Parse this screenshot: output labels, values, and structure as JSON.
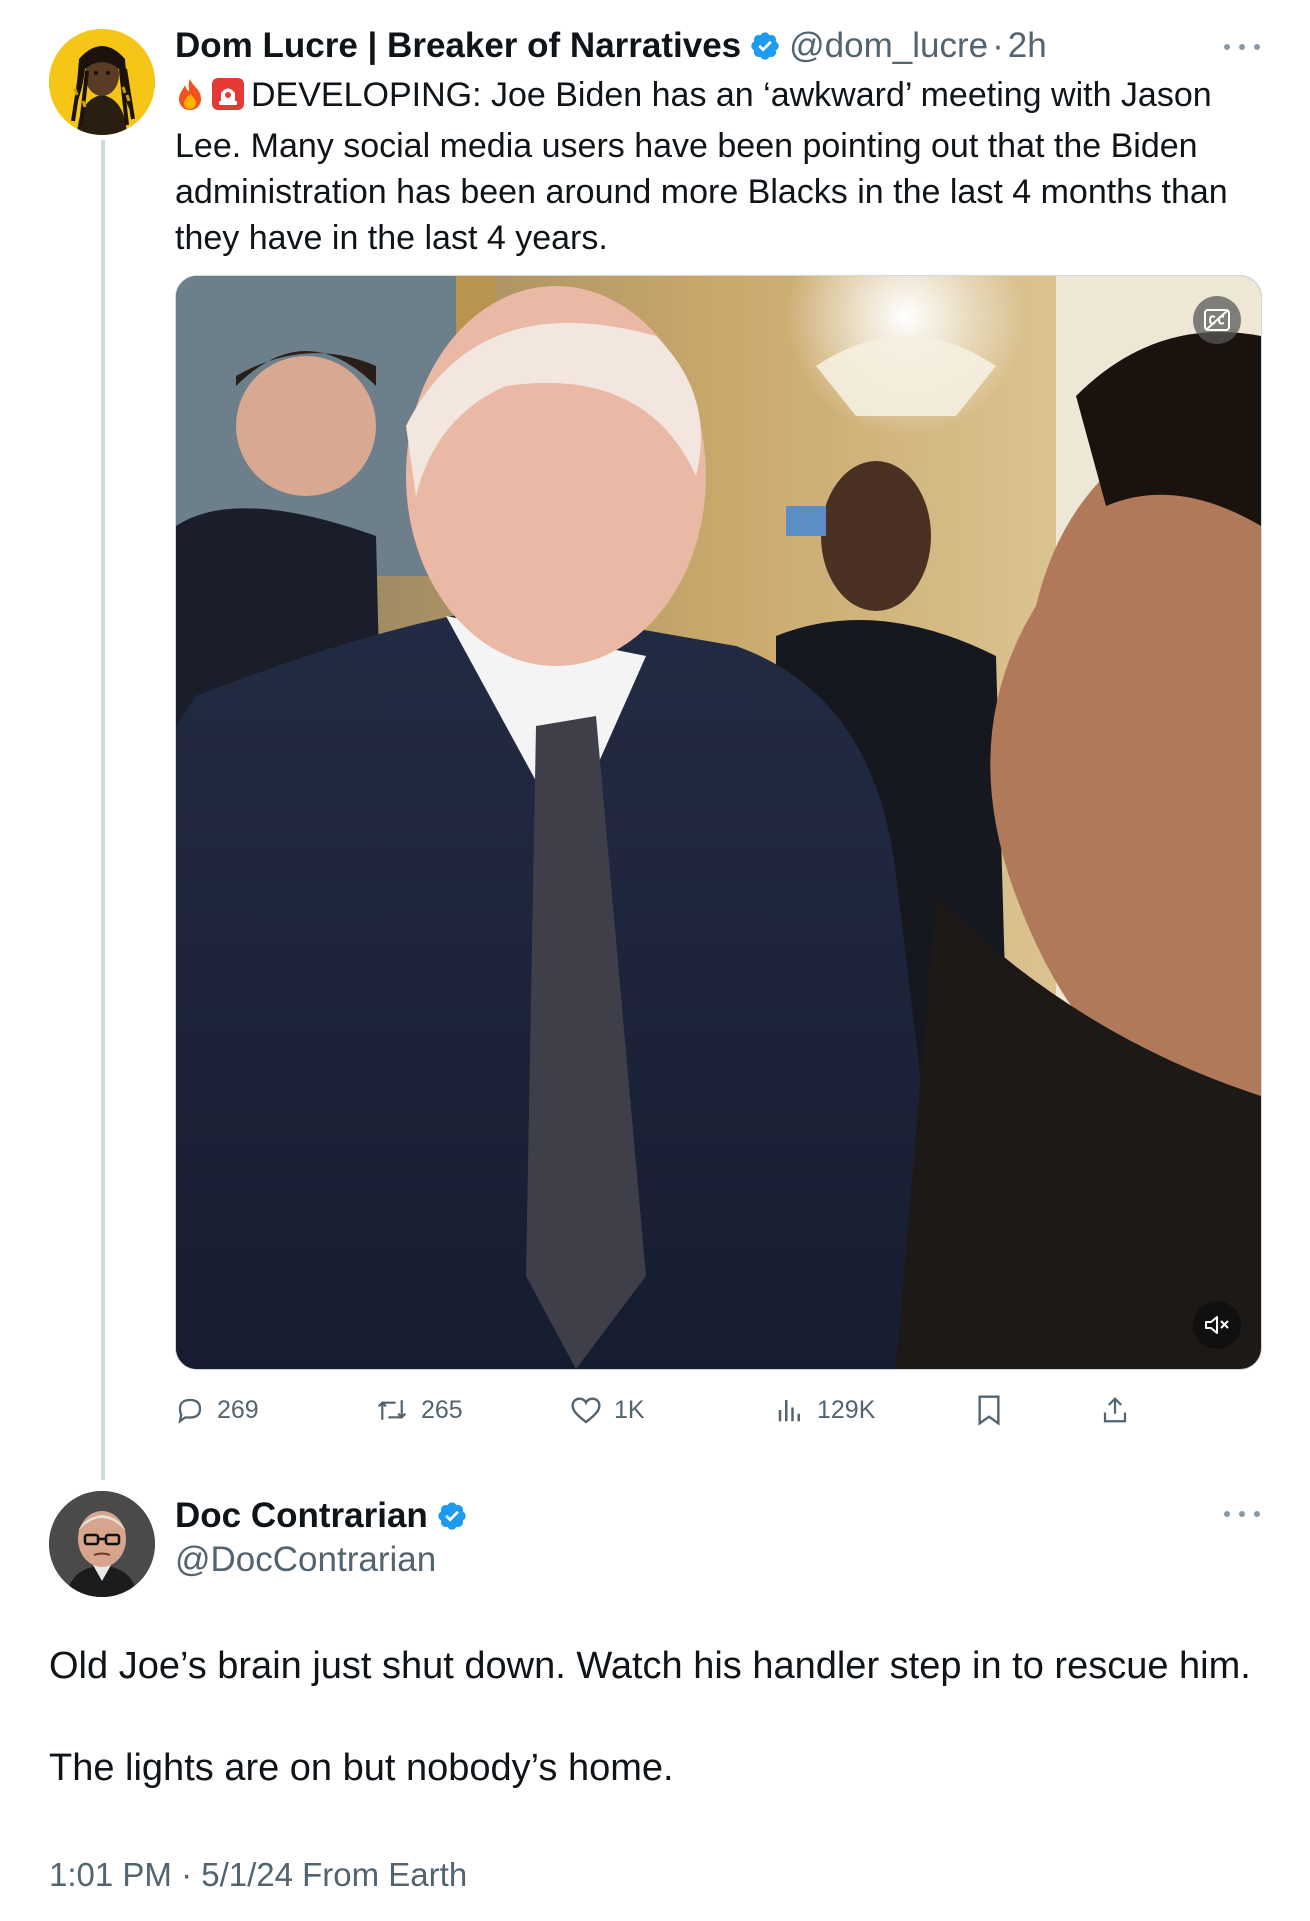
{
  "tweet": {
    "display_name": "Dom Lucre | Breaker of Narratives",
    "handle": "@dom_lucre",
    "separator": "·",
    "time": "2h",
    "emojis": [
      "fire-emoji",
      "siren-emoji"
    ],
    "text": "DEVELOPING: Joe Biden has an ‘awkward’ meeting with Jason Lee. Many social media users have been pointing out that the Biden administration has been around more Blacks in the last 4 months than they have in the last 4 years.",
    "media": {
      "type": "video",
      "icons": [
        "closed-captions-icon",
        "mute-icon"
      ]
    },
    "actions": {
      "replies": "269",
      "reposts": "265",
      "likes": "1K",
      "views": "129K"
    }
  },
  "reply": {
    "display_name": "Doc Contrarian",
    "handle": "@DocContrarian",
    "paragraphs": [
      "Old Joe’s brain just shut down. Watch his handler step in to rescue him.",
      "The lights are on but nobody’s home."
    ],
    "meta": "1:01 PM · 5/1/24 From Earth"
  },
  "colors": {
    "verified": "#1d9bf0",
    "secondary_text": "#536471",
    "thread_line": "#cfd9de"
  }
}
